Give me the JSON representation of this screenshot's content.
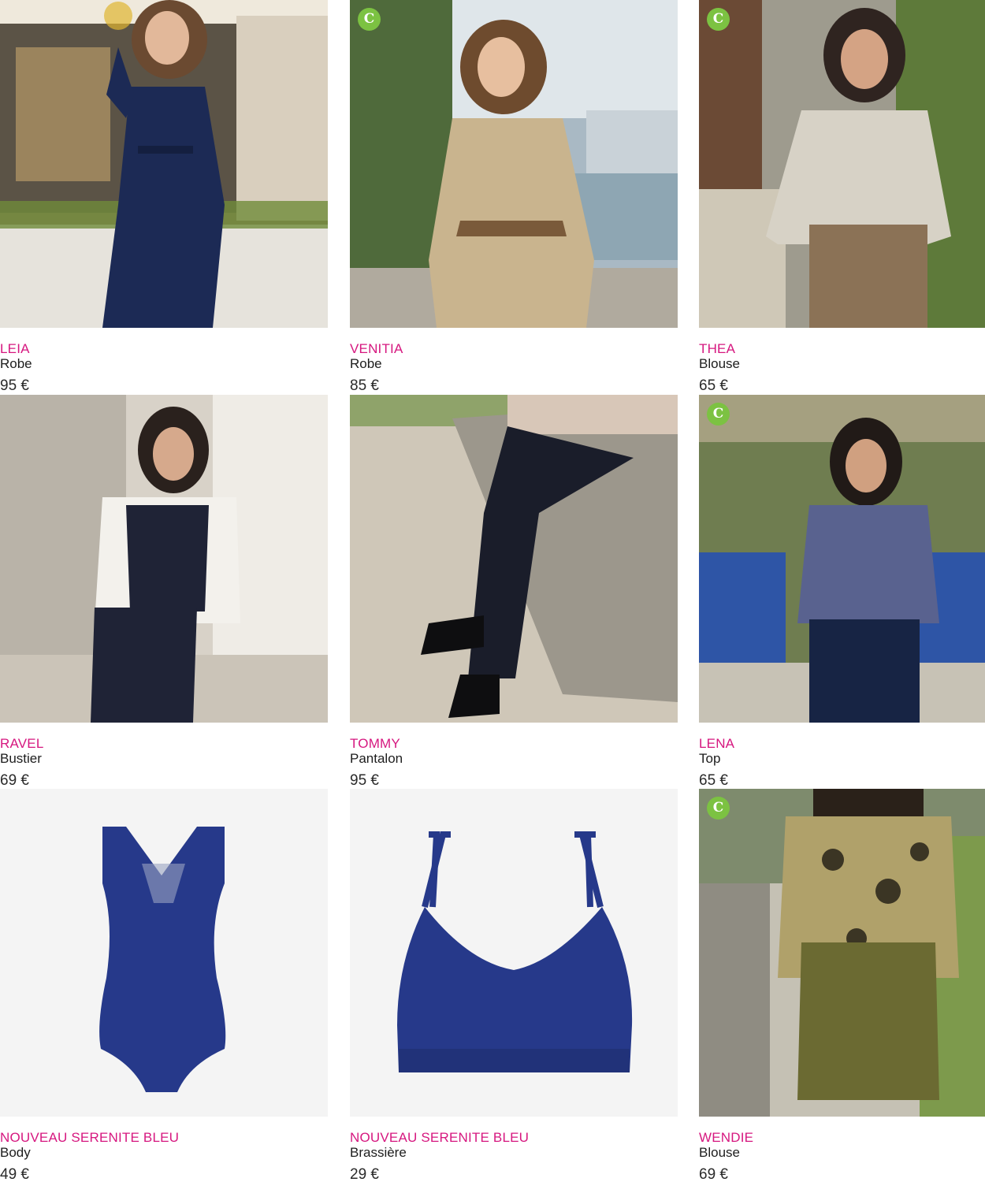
{
  "badge_symbol": "C",
  "colors": {
    "name_accent": "#d6177f",
    "badge": "#7cc242",
    "navy": "#1c2a55",
    "royal_blue": "#26398a"
  },
  "products": [
    {
      "name": "LEIA",
      "type": "Robe",
      "price": "95 €",
      "badge": false,
      "image_icon": "woman-navy-shirt-dress-photo"
    },
    {
      "name": "VENITIA",
      "type": "Robe",
      "price": "85 €",
      "badge": true,
      "image_icon": "woman-beige-print-dress-photo"
    },
    {
      "name": "THEA",
      "type": "Blouse",
      "price": "65 €",
      "badge": true,
      "image_icon": "woman-floral-blouse-photo"
    },
    {
      "name": "RAVEL",
      "type": "Bustier",
      "price": "69 €",
      "badge": false,
      "image_icon": "woman-pinstripe-bustier-photo"
    },
    {
      "name": "TOMMY",
      "type": "Pantalon",
      "price": "95 €",
      "badge": false,
      "image_icon": "pinstripe-trousers-photo"
    },
    {
      "name": "LENA",
      "type": "Top",
      "price": "65 €",
      "badge": true,
      "image_icon": "woman-blue-print-top-photo"
    },
    {
      "name": "NOUVEAU SERENITE BLEU",
      "type": "Body",
      "price": "49 €",
      "badge": false,
      "image_icon": "blue-bodysuit-photo"
    },
    {
      "name": "NOUVEAU SERENITE BLEU",
      "type": "Brassière",
      "price": "29 €",
      "badge": false,
      "image_icon": "blue-bra-photo"
    },
    {
      "name": "WENDIE",
      "type": "Blouse",
      "price": "69 €",
      "badge": true,
      "image_icon": "woman-leopard-blouse-photo"
    }
  ]
}
